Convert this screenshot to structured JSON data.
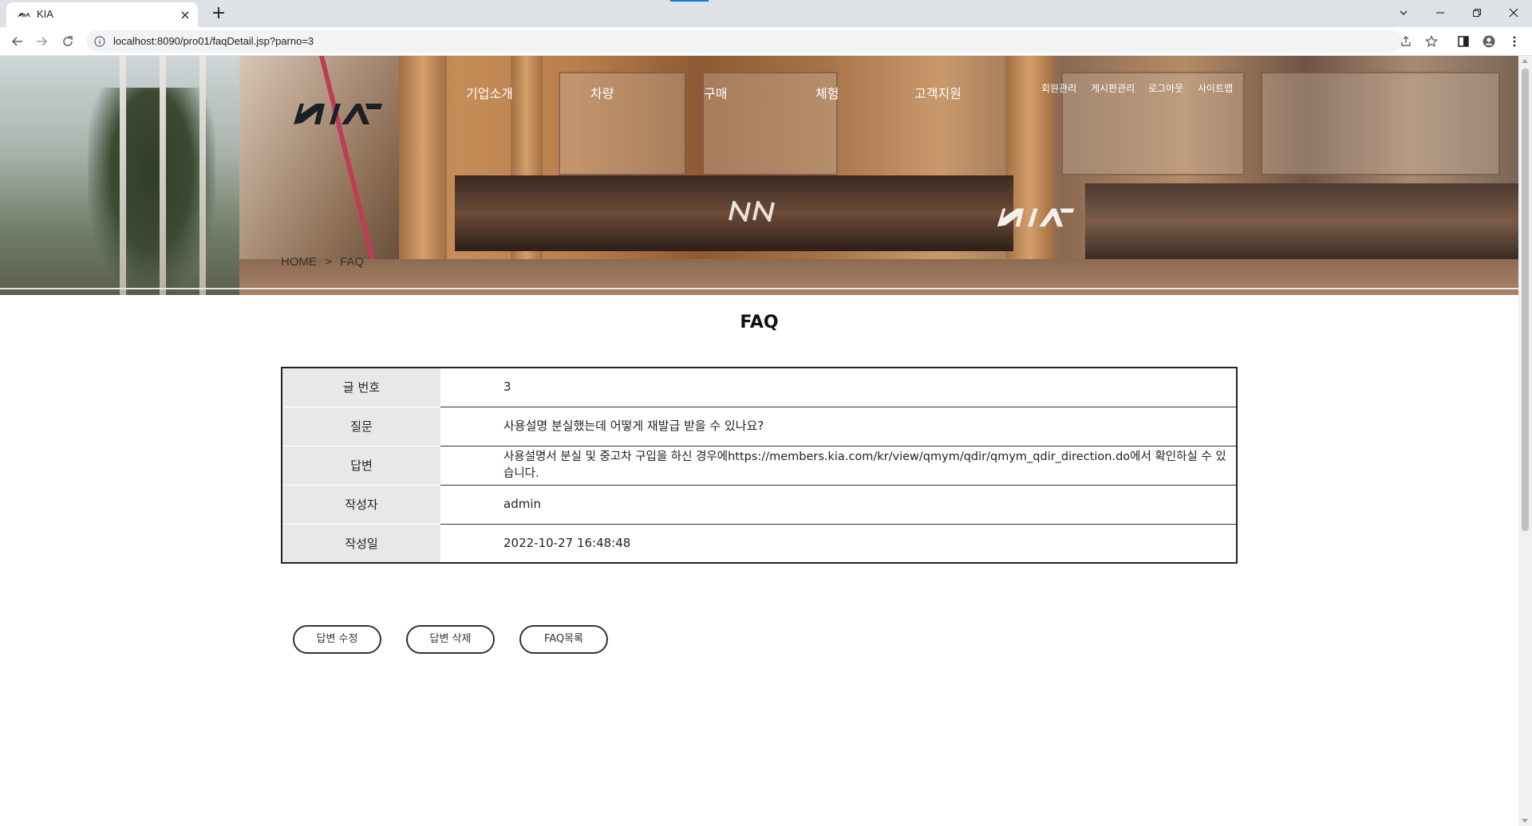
{
  "browser": {
    "tab_title": "KIA",
    "tab_close": "×",
    "new_tab": "+",
    "url": "localhost:8090/pro01/faqDetail.jsp?parno=3"
  },
  "header": {
    "logo": "KIA",
    "nav": [
      "기업소개",
      "차량",
      "구매",
      "체험",
      "고객지원"
    ],
    "util": [
      "회원관리",
      "게시판관리",
      "로그아웃",
      "사이트맵"
    ]
  },
  "breadcrumb": {
    "home": "HOME",
    "separator": ">",
    "current": "FAQ"
  },
  "page": {
    "title": "FAQ"
  },
  "detail": {
    "rows": [
      {
        "label": "글 번호",
        "value": "3"
      },
      {
        "label": "질문",
        "value": "사용설명 분실했는데 어떻게 재발급 받을 수 있나요?"
      },
      {
        "label": "답변",
        "value": "사용설명서 분실 및 중고차 구입을 하신 경우에https://members.kia.com/kr/view/qmym/qdir/qmym_qdir_direction.do에서 확인하실 수 있습니다."
      },
      {
        "label": "작성자",
        "value": "admin"
      },
      {
        "label": "작성일",
        "value": "2022-10-27 16:48:48"
      }
    ]
  },
  "actions": {
    "edit": "답변 수정",
    "delete": "답변 삭제",
    "list": "FAQ목록"
  },
  "colors": {
    "accent": "#1a73e8",
    "table_header_bg": "#e8e8e8",
    "border": "#222222"
  },
  "icons": [
    "kia-logo-icon",
    "back-arrow-icon",
    "forward-arrow-icon",
    "reload-icon",
    "info-icon",
    "share-icon",
    "star-icon",
    "side-panel-icon",
    "profile-icon",
    "menu-dots-icon",
    "chevron-down-icon",
    "minimize-icon",
    "restore-icon",
    "close-icon"
  ]
}
